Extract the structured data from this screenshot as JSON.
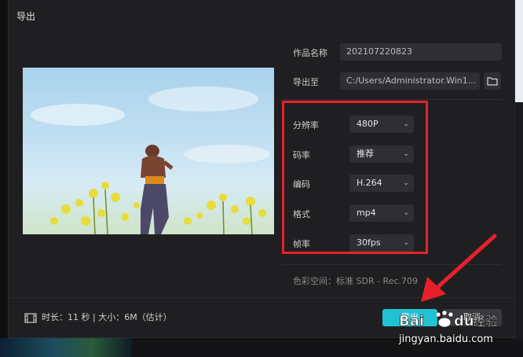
{
  "dialog": {
    "title": "导出"
  },
  "form": {
    "name_label": "作品名称",
    "name_value": "202107220823",
    "path_label": "导出至",
    "path_value": "C:/Users/Administrator.Win1..."
  },
  "settings": [
    {
      "label": "分辨率",
      "value": "480P"
    },
    {
      "label": "码率",
      "value": "推荐"
    },
    {
      "label": "编码",
      "value": "H.264"
    },
    {
      "label": "格式",
      "value": "mp4"
    },
    {
      "label": "帧率",
      "value": "30fps"
    }
  ],
  "color_space": "色彩空间：标准 SDR - Rec.709",
  "footer": {
    "info": "时长：11 秒 | 大小：6M（估计）"
  },
  "buttons": {
    "export": "导出",
    "cancel": "取消"
  },
  "watermark": {
    "brand": "Baidu 经验",
    "url": "jingyan.baidu.com"
  },
  "colors": {
    "accent": "#21c3d2",
    "highlight": "#e8202a",
    "arrow": "#e8202a"
  },
  "icons": [
    "folder-icon",
    "chevron-down-icon",
    "film-icon",
    "arrow-annotation"
  ]
}
